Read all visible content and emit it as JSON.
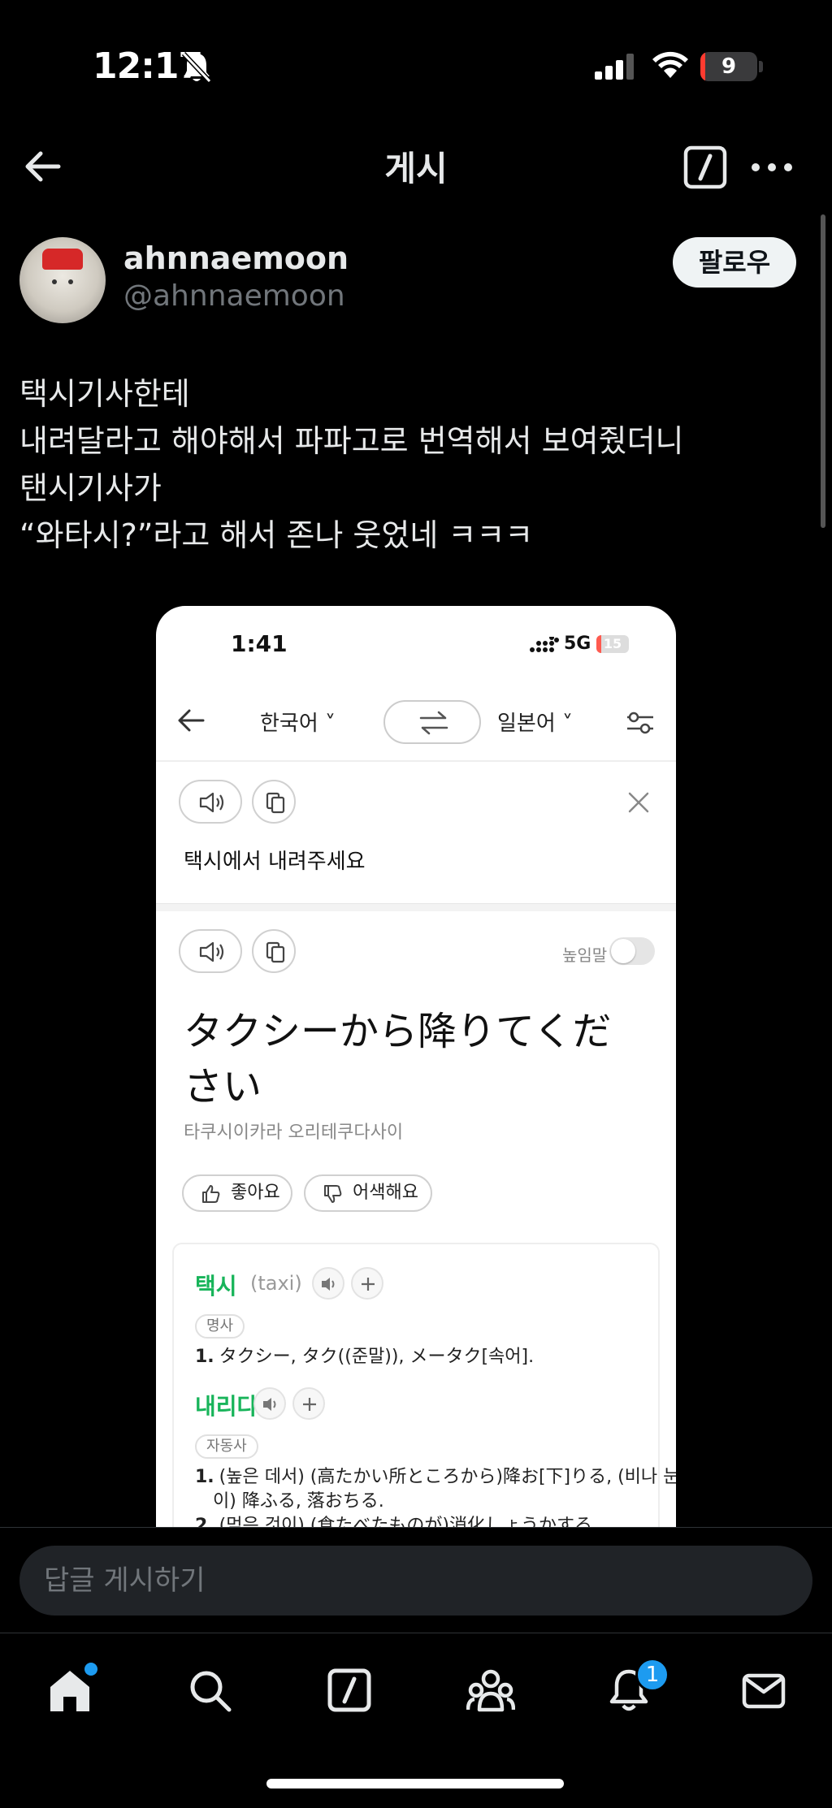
{
  "status_bar": {
    "time": "12:17",
    "battery": "9",
    "battery_level_percent": 9,
    "icons": [
      "bell-slash-icon",
      "signal-icon",
      "wifi-icon",
      "battery-icon"
    ]
  },
  "header": {
    "title": "게시",
    "icons": [
      "back-arrow-icon",
      "compose-icon",
      "more-icon"
    ]
  },
  "author": {
    "name": "ahnnaemoon",
    "handle": "@ahnnaemoon",
    "follow_label": "팔로우"
  },
  "post": {
    "lines": [
      "택시기사한테",
      "내려달라고 해야해서 파파고로 번역해서 보여줬더니",
      "탠시기사가",
      "“와타시?”라고 해서 존나 웃었네 ㅋㅋㅋ"
    ]
  },
  "embedded_screenshot": {
    "status": {
      "time": "1:41",
      "network": "5G",
      "battery": "15",
      "battery_level_percent": 15
    },
    "nav": {
      "source_lang": "한국어",
      "target_lang": "일본어"
    },
    "input_text": "택시에서 내려주세요",
    "honorific_label": "높임말",
    "honorific_on": false,
    "result_lines": [
      "タクシーから降りてくだ",
      "さい"
    ],
    "pronunciation": "타쿠시이카라 오리테쿠다사이",
    "feedback": {
      "like": "좋아요",
      "awkward": "어색해요"
    },
    "dictionary": [
      {
        "word": "택시",
        "origin": "(taxi)",
        "pos": "명사",
        "defs": [
          {
            "num": "1.",
            "text": "タクシー, タク((준말)), メータク[속어]."
          }
        ]
      },
      {
        "word": "내리다",
        "origin": "",
        "pos": "자동사",
        "defs": [
          {
            "num": "1.",
            "text": "(높은 데서) (高たかい所ところから)降お[下]りる, (비나 눈"
          },
          {
            "num": "",
            "text": "이) 降ふる, 落おちる."
          },
          {
            "num": "2.",
            "text": "(먹은 것이) (食たべたものが)消化しょうかする."
          }
        ]
      }
    ],
    "colors": {
      "accent_green": "#18b45a"
    }
  },
  "reply": {
    "placeholder": "답글 게시하기"
  },
  "bottom_nav": {
    "items": [
      "home-icon",
      "search-icon",
      "grok-icon",
      "communities-icon",
      "notifications-icon",
      "messages-icon"
    ],
    "notifications_badge": "1"
  },
  "colors": {
    "background": "#000000",
    "text": "#e7e9ea",
    "muted": "#71767b",
    "accent_blue": "#1d9bf0"
  }
}
